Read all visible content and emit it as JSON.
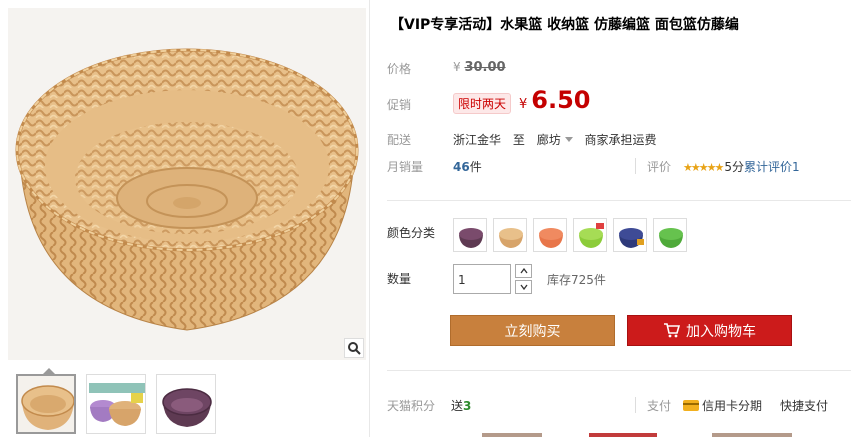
{
  "product": {
    "title": "【VIP专享活动】水果篮 收纳篮 仿藤编篮 面包篮仿藤编"
  },
  "price": {
    "label": "价格",
    "currency": "¥",
    "original": "30.00"
  },
  "promo": {
    "label": "促销",
    "tag": "限时两天",
    "currency": "¥",
    "price": "6.50"
  },
  "shipping": {
    "label": "配送",
    "from": "浙江金华",
    "to_word": "至",
    "destination": "廊坊",
    "fee_note": "商家承担运费"
  },
  "sales": {
    "label": "月销量",
    "count": "46",
    "unit": "件"
  },
  "rating": {
    "label": "评价",
    "stars": "★★★★★",
    "value": "5分",
    "count_text": "累计评价1"
  },
  "color": {
    "label": "颜色分类",
    "swatches": [
      "purple",
      "natural",
      "orange",
      "lime",
      "navy",
      "green"
    ]
  },
  "quantity": {
    "label": "数量",
    "value": "1",
    "stock": "库存725件"
  },
  "buttons": {
    "buy_now": "立刻购买",
    "add_to_cart": "加入购物车"
  },
  "points": {
    "label": "天猫积分",
    "gift_prefix": "送",
    "gift_value": "3"
  },
  "payment": {
    "label": "支付",
    "credit_card": "信用卡分期",
    "quick_pay": "快捷支付"
  },
  "colors": {
    "promo_red": "#c40000",
    "buy_button": "#c8803d",
    "cart_button": "#cc1b1b",
    "link_blue": "#336699",
    "star_gold": "#e8a317"
  },
  "icons": [
    "zoom-icon",
    "cart-icon",
    "credit-card-icon",
    "chevron-up-icon",
    "chevron-down-icon",
    "caret-down-icon"
  ]
}
